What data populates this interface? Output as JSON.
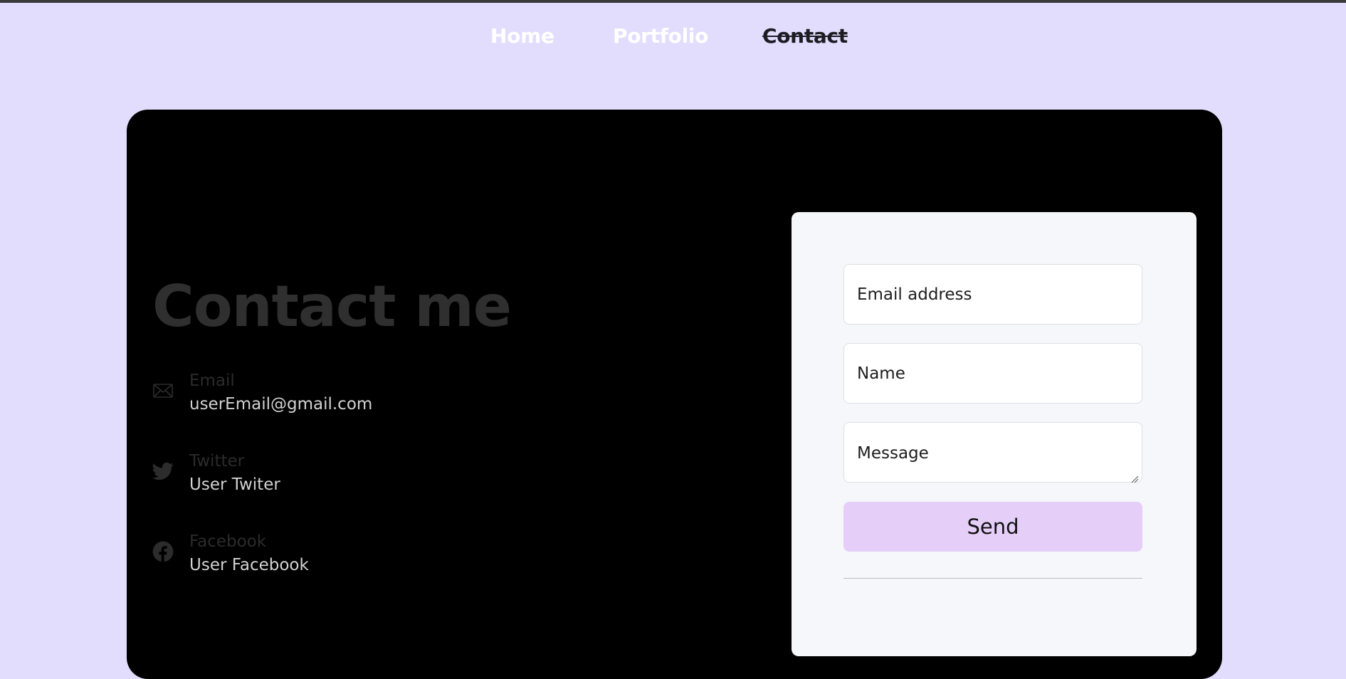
{
  "nav": {
    "items": [
      {
        "label": "Home",
        "active": false
      },
      {
        "label": "Portfolio",
        "active": false
      },
      {
        "label": "Contact",
        "active": true
      }
    ]
  },
  "contact": {
    "title": "Contact me",
    "items": [
      {
        "icon": "envelope-icon",
        "label": "Email",
        "value": "userEmail@gmail.com"
      },
      {
        "icon": "twitter-icon",
        "label": "Twitter",
        "value": "User Twiter"
      },
      {
        "icon": "facebook-icon",
        "label": "Facebook",
        "value": "User Facebook"
      }
    ]
  },
  "form": {
    "email_placeholder": "Email address",
    "name_placeholder": "Name",
    "message_placeholder": "Message",
    "send_label": "Send"
  },
  "colors": {
    "page_background": "#e3ddfd",
    "card_background": "#000000",
    "form_background": "#f6f7fa",
    "send_button": "#e5cff8",
    "heading_text": "#2f2f2f"
  }
}
